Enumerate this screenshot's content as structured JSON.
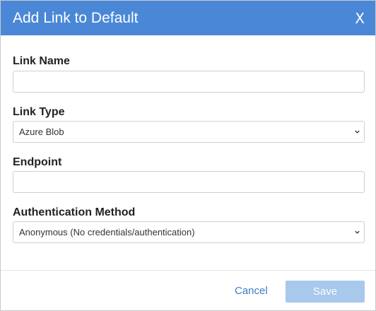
{
  "dialog": {
    "title": "Add Link to Default",
    "close_label": "X"
  },
  "form": {
    "link_name": {
      "label": "Link Name",
      "value": ""
    },
    "link_type": {
      "label": "Link Type",
      "selected": "Azure Blob"
    },
    "endpoint": {
      "label": "Endpoint",
      "value": ""
    },
    "auth_method": {
      "label": "Authentication Method",
      "selected": "Anonymous (No credentials/authentication)"
    }
  },
  "footer": {
    "cancel_label": "Cancel",
    "save_label": "Save",
    "save_disabled": true
  },
  "colors": {
    "header_bg": "#4a88d7",
    "accent": "#3b7cc9",
    "save_disabled_bg": "#a8c8ec"
  },
  "icons": {
    "close": "close-icon",
    "dropdown": "chevron-down-icon"
  }
}
